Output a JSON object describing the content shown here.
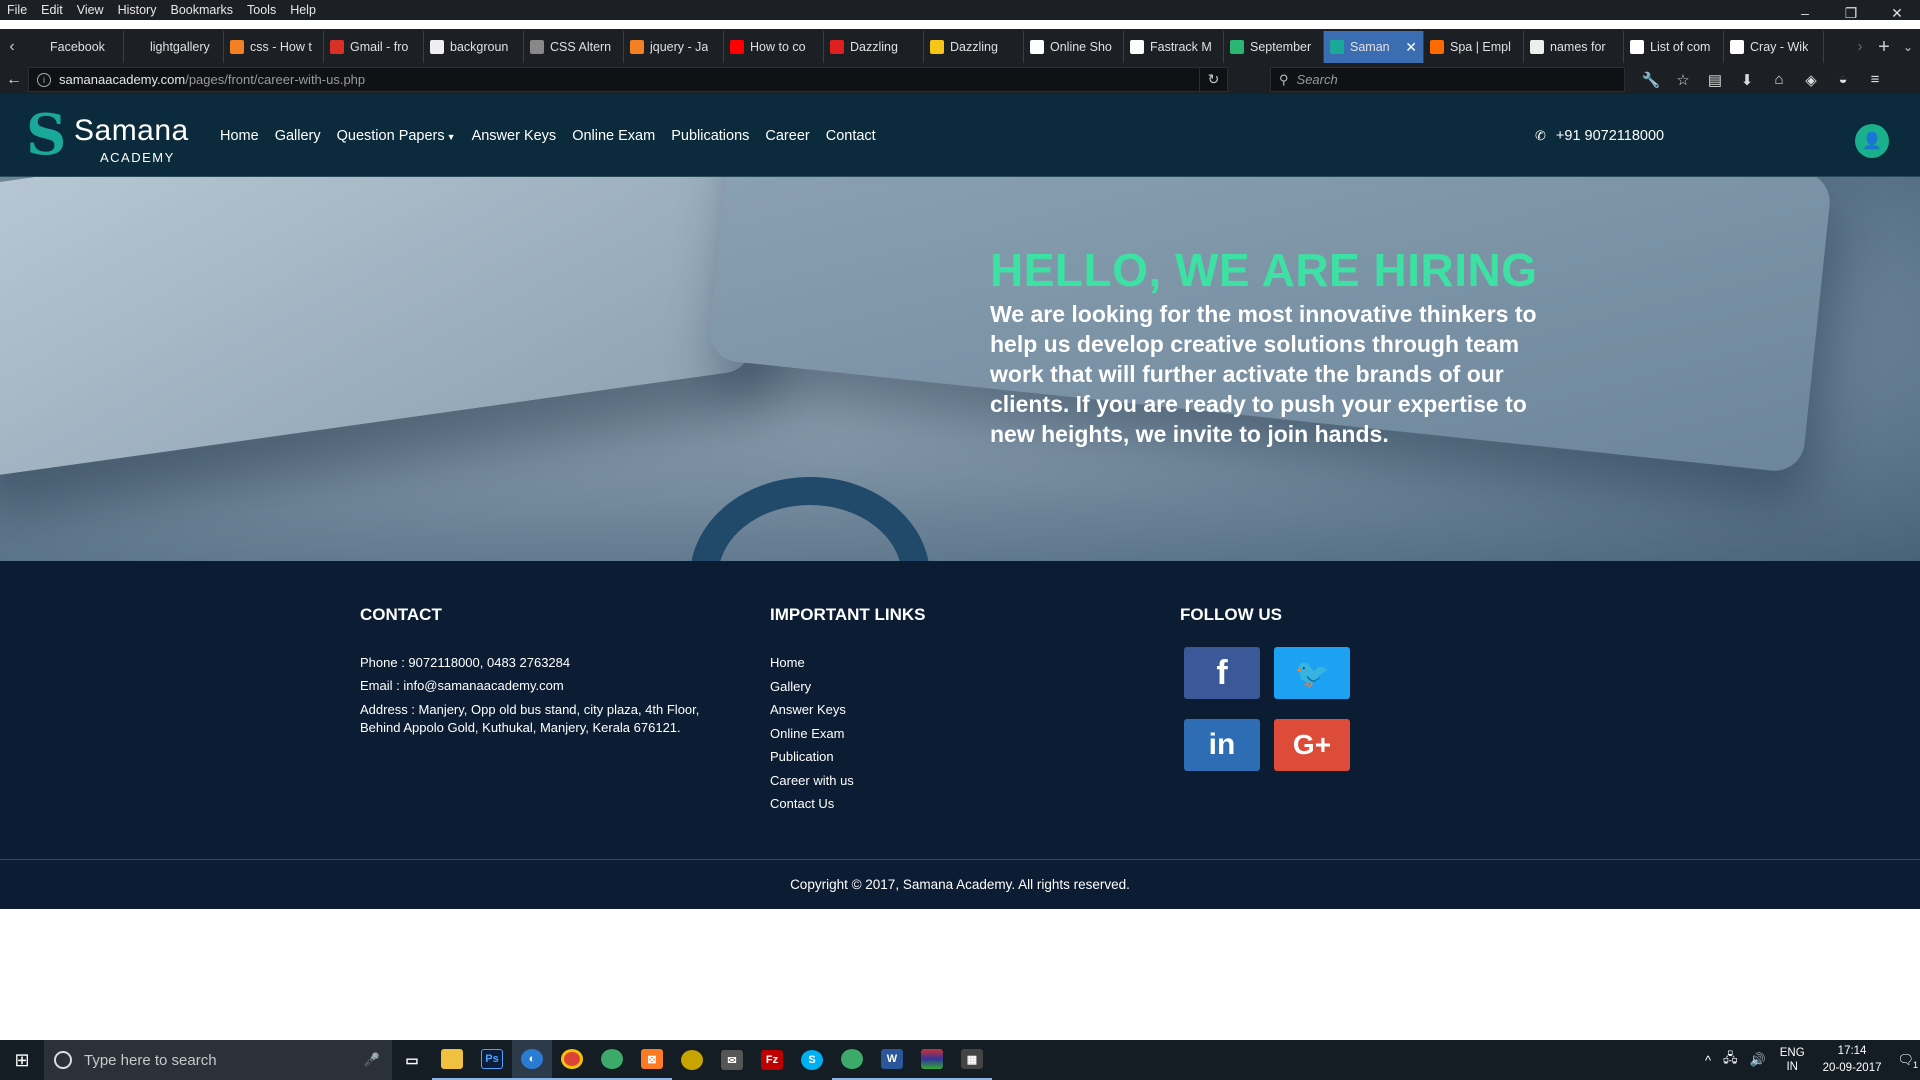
{
  "menubar": {
    "items": [
      "File",
      "Edit",
      "View",
      "History",
      "Bookmarks",
      "Tools",
      "Help"
    ]
  },
  "window_controls": {
    "minimize": "–",
    "restore": "❐",
    "close": "✕"
  },
  "tabs": [
    {
      "label": "Facebook",
      "color": "#1c1f24"
    },
    {
      "label": "lightgallery",
      "color": "#1c1f24"
    },
    {
      "label": "css - How t",
      "color": "#f48024"
    },
    {
      "label": "Gmail - fro",
      "color": "#d93025"
    },
    {
      "label": "backgroun",
      "color": "#eeeeee"
    },
    {
      "label": "CSS Altern",
      "color": "#888888"
    },
    {
      "label": "jquery - Ja",
      "color": "#f48024"
    },
    {
      "label": "How to co",
      "color": "#ff0000"
    },
    {
      "label": "Dazzling",
      "color": "#e02020"
    },
    {
      "label": "Dazzling",
      "color": "#f5c518"
    },
    {
      "label": "Online Sho",
      "color": "#ffffff"
    },
    {
      "label": "Fastrack M",
      "color": "#ffffff"
    },
    {
      "label": "September",
      "color": "#2bb673"
    },
    {
      "label": "Saman",
      "color": "#1aa89a",
      "active": true
    },
    {
      "label": "Spa | Empl",
      "color": "#ff6a00"
    },
    {
      "label": "names for",
      "color": "#eeeeee"
    },
    {
      "label": "List of com",
      "color": "#ffffff"
    },
    {
      "label": "Cray - Wik",
      "color": "#ffffff"
    }
  ],
  "address": {
    "host": "samanaacademy.com",
    "path": "/pages/front/career-with-us.php"
  },
  "search": {
    "placeholder": "Search"
  },
  "site": {
    "logo_name": "Samana",
    "logo_sub": "ACADEMY",
    "nav": [
      "Home",
      "Gallery",
      "Question Papers",
      "Answer Keys",
      "Online Exam",
      "Publications",
      "Career",
      "Contact"
    ],
    "phone": "+91 9072118000"
  },
  "hero": {
    "title": "HELLO, WE ARE HIRING",
    "text": "We are looking for the most innovative thinkers to help us develop creative solutions through team work that will further activate the brands of our clients. If you are ready to push your expertise to new heights, we invite to join hands."
  },
  "footer": {
    "contact_title": "CONTACT",
    "phone": "Phone : 9072118000, 0483 2763284",
    "email": "Email : info@samanaacademy.com",
    "address": "Address : Manjery, Opp old bus stand, city plaza, 4th Floor, Behind Appolo Gold, Kuthukal, Manjery, Kerala 676121.",
    "links_title": "IMPORTANT LINKS",
    "links": [
      "Home",
      "Gallery",
      "Answer Keys",
      "Online Exam",
      "Publication",
      "Career with us",
      "Contact Us"
    ],
    "follow_title": "FOLLOW US",
    "social": [
      {
        "name": "facebook",
        "glyph": "f",
        "color": "#3b5998"
      },
      {
        "name": "twitter",
        "glyph": "🐦",
        "color": "#1da1f2"
      },
      {
        "name": "linkedin",
        "glyph": "in",
        "color": "#2e6db4"
      },
      {
        "name": "googleplus",
        "glyph": "G+",
        "color": "#dd4b39"
      }
    ],
    "copyright": "Copyright © 2017, Samana Academy. All rights reserved."
  },
  "taskbar": {
    "search_placeholder": "Type here to search",
    "lang1": "ENG",
    "lang2": "IN",
    "time": "17:14",
    "date": "20-09-2017",
    "notif_count": "1"
  }
}
